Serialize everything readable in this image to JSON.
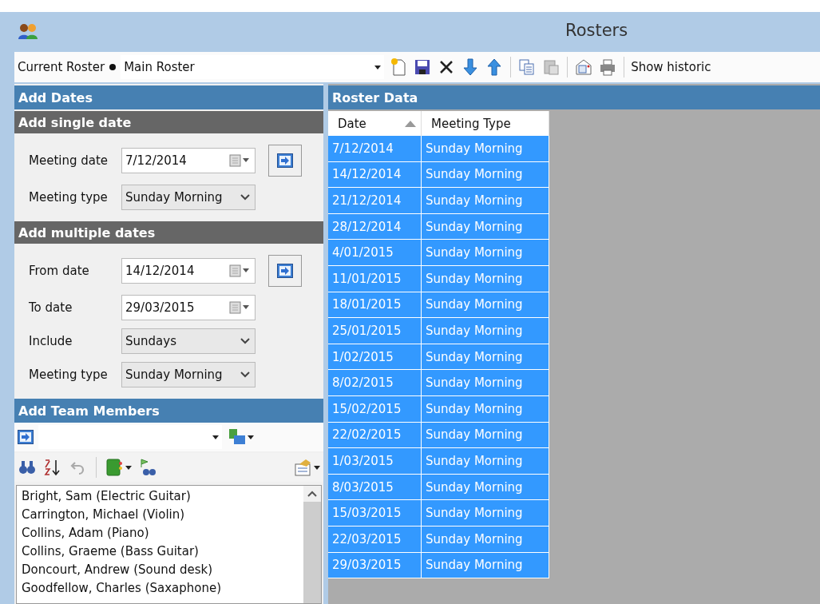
{
  "window": {
    "title": "Rosters"
  },
  "toolbar": {
    "label": "Current Roster",
    "roster": "Main Roster",
    "show_historic": "Show historic"
  },
  "add_dates": {
    "title": "Add Dates",
    "single": {
      "title": "Add single date",
      "fields": [
        {
          "kind": "date",
          "label": "Meeting date",
          "value": "7/12/2014"
        },
        {
          "kind": "select",
          "label": "Meeting type",
          "value": "Sunday Morning"
        }
      ]
    },
    "multiple": {
      "title": "Add multiple dates",
      "fields": [
        {
          "kind": "date",
          "label": "From date",
          "value": "14/12/2014"
        },
        {
          "kind": "date",
          "label": "To date",
          "value": "29/03/2015"
        },
        {
          "kind": "select",
          "label": "Include",
          "value": "Sundays"
        },
        {
          "kind": "select",
          "label": "Meeting type",
          "value": "Sunday Morning"
        }
      ]
    }
  },
  "team": {
    "title": "Add Team Members",
    "members": [
      "Bright, Sam (Electric Guitar)",
      "Carrington, Michael (Violin)",
      "Collins, Adam (Piano)",
      "Collins, Graeme (Bass Guitar)",
      "Doncourt, Andrew (Sound desk)",
      "Goodfellow, Charles (Saxaphone)"
    ]
  },
  "roster_data": {
    "title": "Roster Data",
    "columns": [
      "Date",
      "Meeting Type"
    ],
    "rows": [
      {
        "date": "7/12/2014",
        "type": "Sunday Morning",
        "selected": true
      },
      {
        "date": "14/12/2014",
        "type": "Sunday Morning",
        "selected": true
      },
      {
        "date": "21/12/2014",
        "type": "Sunday Morning",
        "selected": true
      },
      {
        "date": "28/12/2014",
        "type": "Sunday Morning",
        "selected": true
      },
      {
        "date": "4/01/2015",
        "type": "Sunday Morning",
        "selected": true
      },
      {
        "date": "11/01/2015",
        "type": "Sunday Morning",
        "selected": true
      },
      {
        "date": "18/01/2015",
        "type": "Sunday Morning",
        "selected": true
      },
      {
        "date": "25/01/2015",
        "type": "Sunday Morning",
        "selected": true
      },
      {
        "date": "1/02/2015",
        "type": "Sunday Morning",
        "selected": true
      },
      {
        "date": "8/02/2015",
        "type": "Sunday Morning",
        "selected": true
      },
      {
        "date": "15/02/2015",
        "type": "Sunday Morning",
        "selected": true
      },
      {
        "date": "22/02/2015",
        "type": "Sunday Morning",
        "selected": true
      },
      {
        "date": "1/03/2015",
        "type": "Sunday Morning",
        "selected": true
      },
      {
        "date": "8/03/2015",
        "type": "Sunday Morning",
        "selected": true
      },
      {
        "date": "15/03/2015",
        "type": "Sunday Morning",
        "selected": true
      },
      {
        "date": "22/03/2015",
        "type": "Sunday Morning",
        "selected": true
      },
      {
        "date": "29/03/2015",
        "type": "Sunday Morning",
        "selected": true
      }
    ]
  }
}
